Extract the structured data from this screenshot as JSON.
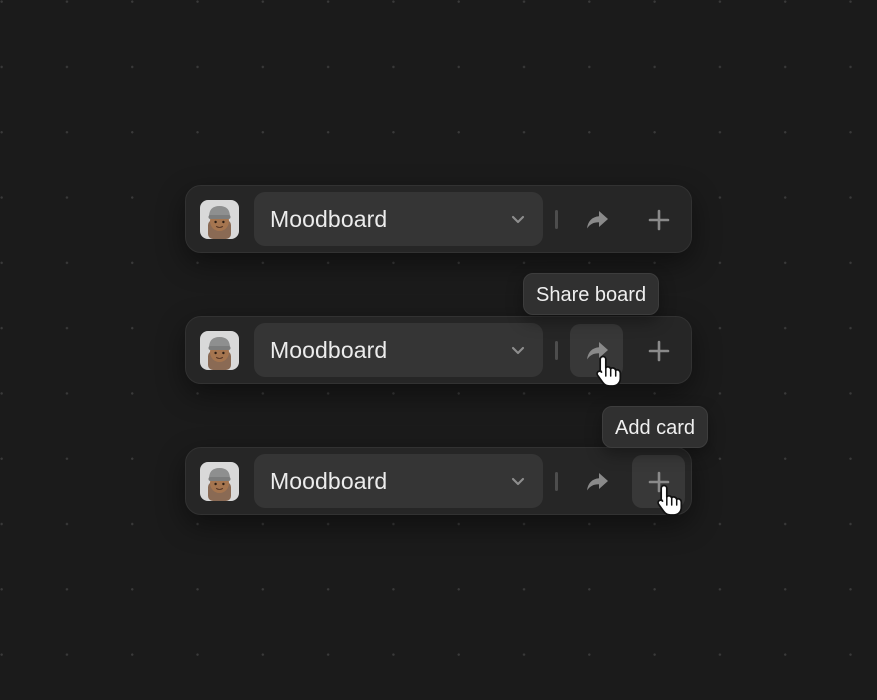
{
  "toolbars": [
    {
      "board_name": "Moodboard",
      "hovered": null,
      "tooltip": ""
    },
    {
      "board_name": "Moodboard",
      "hovered": "share",
      "tooltip": "Share board"
    },
    {
      "board_name": "Moodboard",
      "hovered": "add",
      "tooltip": "Add card"
    }
  ],
  "icons": {
    "avatar": "avatar-memoji-beanie",
    "board_dropdown": "chevron-down-icon",
    "share": "share-arrow-icon",
    "add": "plus-icon",
    "pointer": "hand-pointer-cursor"
  },
  "colors": {
    "background": "#1b1b1b",
    "toolbar": "#262626",
    "select": "#353535",
    "hover": "#383838",
    "icon": "#8a8a8a",
    "text": "#ececec"
  }
}
